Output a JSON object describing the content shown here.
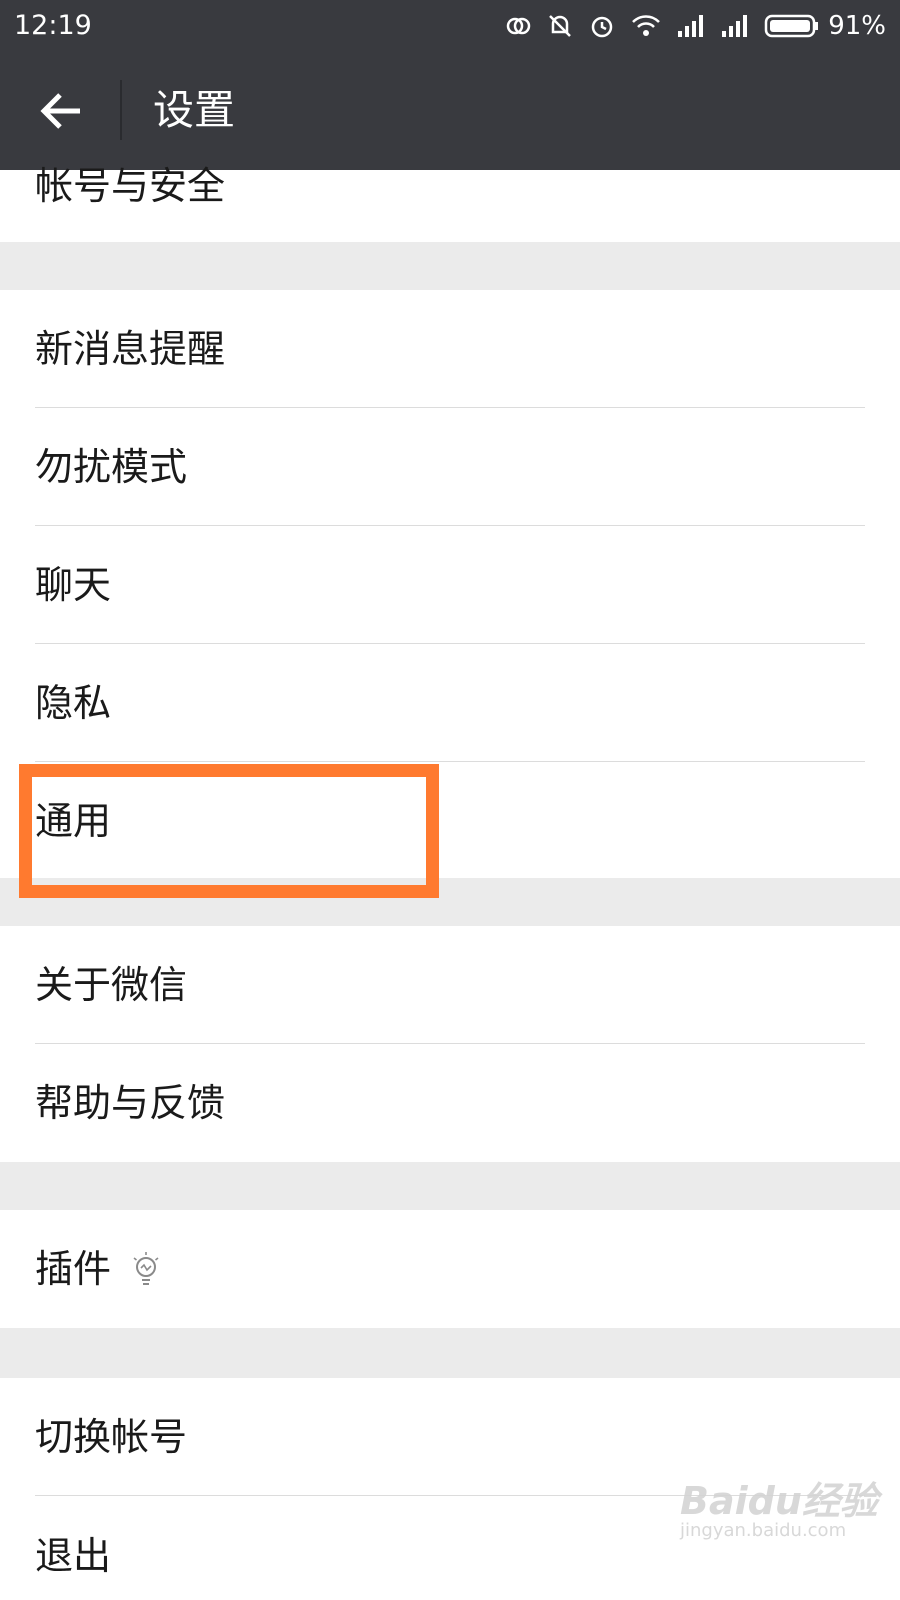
{
  "status_bar": {
    "time": "12:19",
    "battery_percent": "91%",
    "icons": [
      "sync-icon",
      "bell-off-icon",
      "alarm-icon",
      "wifi-icon",
      "signal-icon",
      "signal-icon",
      "battery-icon"
    ]
  },
  "toolbar": {
    "back_icon": "arrow-left-icon",
    "title": "设置"
  },
  "settings": {
    "account_security": "帐号与安全",
    "new_message_alerts": "新消息提醒",
    "do_not_disturb": "勿扰模式",
    "chat": "聊天",
    "privacy": "隐私",
    "general": "通用",
    "about_wechat": "关于微信",
    "help_feedback": "帮助与反馈",
    "plugins": "插件",
    "switch_account": "切换帐号",
    "logout": "退出"
  },
  "plugins_icon": "lightbulb-icon",
  "annotation": {
    "highlight_color": "#ff7a2f",
    "highlighted_item": "通用"
  },
  "watermark": {
    "brand": "Baidu经验",
    "site": "jingyan.baidu.com"
  },
  "colors": {
    "bar_bg": "#393a3f",
    "page_bg": "#ebebeb",
    "row_bg": "#ffffff"
  }
}
